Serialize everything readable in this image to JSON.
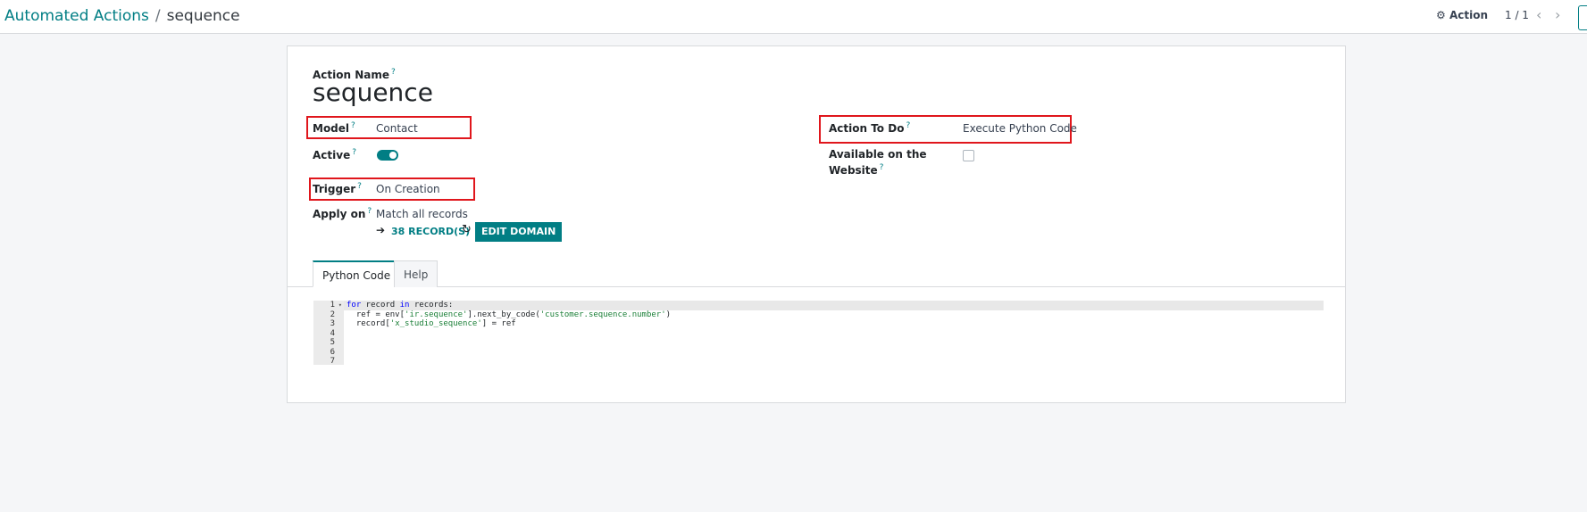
{
  "breadcrumb": {
    "parent": "Automated Actions",
    "separator": "/",
    "current": "sequence"
  },
  "header": {
    "action_icon": "⚙",
    "action_label": "Action",
    "pager_text": "1 / 1",
    "prev_icon": "‹",
    "next_icon": "›"
  },
  "form": {
    "action_name_label": "Action Name",
    "action_name_value": "sequence",
    "help_mark": "?",
    "model_label": "Model",
    "model_value": "Contact",
    "active_label": "Active",
    "active_value": true,
    "trigger_label": "Trigger",
    "trigger_value": "On Creation",
    "apply_on_label": "Apply on",
    "apply_on_value": "Match all records",
    "arrow_icon": "➔",
    "records_link": "38 RECORD(S)",
    "refresh_icon": "↻",
    "edit_domain_label": "EDIT DOMAIN",
    "action_to_do_label": "Action To Do",
    "action_to_do_value": "Execute Python Code",
    "website_label_line1": "Available on the",
    "website_label_line2": "Website",
    "website_value": false
  },
  "tabs": [
    {
      "label": "Python Code",
      "active": true
    },
    {
      "label": "Help",
      "active": false
    }
  ],
  "code_editor": {
    "line_numbers": [
      "1",
      "2",
      "3",
      "4",
      "5",
      "6",
      "7"
    ],
    "fold_marker": "▾",
    "lines": [
      {
        "l1": "for",
        "l2": " record ",
        "l3": "in",
        "l4": " records:"
      },
      {
        "l1": "  ref = env[",
        "l2": "'ir.sequence'",
        "l3": "].next_by_code(",
        "l4": "'customer.sequence.number'",
        "l5": ")"
      },
      {
        "l1": "  record[",
        "l2": "'x_studio_sequence'",
        "l3": "] = ref"
      }
    ]
  },
  "colors": {
    "brand": "#017e84",
    "highlight_box": "#e0161c"
  }
}
